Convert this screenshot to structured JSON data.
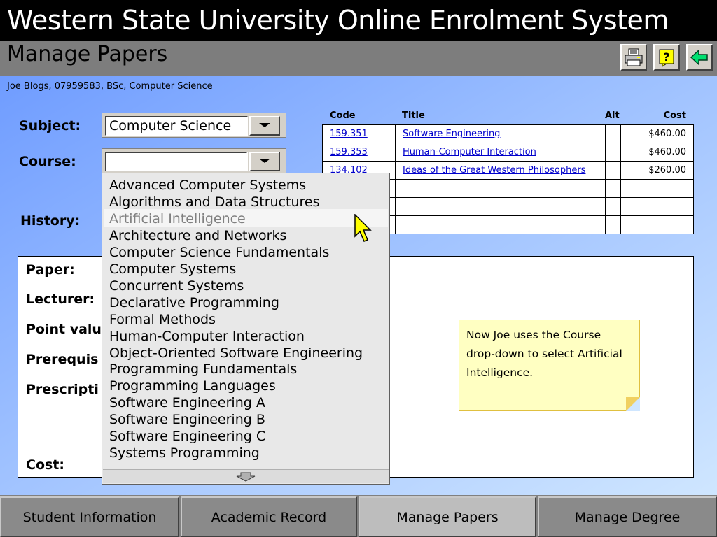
{
  "app": {
    "title": "Western State University Online Enrolment System"
  },
  "header": {
    "page_title": "Manage Papers"
  },
  "toolbar": {
    "icons": [
      "printer-icon",
      "help-icon",
      "back-arrow-icon"
    ]
  },
  "student": {
    "line": "Joe Blogs, 07959583, BSc, Computer Science"
  },
  "form": {
    "subject_label": "Subject:",
    "subject_value": "Computer Science",
    "course_label": "Course:",
    "course_value": "",
    "history_label": "History:"
  },
  "table": {
    "headers": {
      "code": "Code",
      "title": "Title",
      "alt": "Alt",
      "cost": "Cost"
    },
    "rows": [
      {
        "code": "159.351",
        "title": "Software Engineering",
        "cost": "$460.00"
      },
      {
        "code": "159.353",
        "title": "Human-Computer Interaction",
        "cost": "$460.00"
      },
      {
        "code": "134.102",
        "title": "Ideas of the Great Western Philosophers",
        "cost": "$260.00"
      }
    ]
  },
  "detail": {
    "paper_label": "Paper:",
    "lecturer_label": "Lecturer:",
    "points_label": "Point valu",
    "prereq_label": "Prerequis",
    "prescription_label": "Prescripti",
    "cost_label": "Cost:"
  },
  "note": {
    "text": "Now Joe uses the Course drop-down to select Artificial Intelligence."
  },
  "course_list": {
    "highlighted_index": 2,
    "options": [
      "Advanced Computer Systems",
      "Algorithms and Data Structures",
      "Artificial Intelligence",
      "Architecture and Networks",
      "Computer Science Fundamentals",
      "Computer Systems",
      "Concurrent Systems",
      "Declarative Programming",
      "Formal Methods",
      "Human-Computer Interaction",
      "Object-Oriented Software Engineering",
      "Programming Fundamentals",
      "Programming Languages",
      "Software Engineering A",
      "Software Engineering B",
      "Software Engineering C",
      "Systems Programming"
    ]
  },
  "tabs": [
    {
      "label": "Student Information",
      "active": false
    },
    {
      "label": "Academic Record",
      "active": false
    },
    {
      "label": "Manage Papers",
      "active": true
    },
    {
      "label": "Manage Degree",
      "active": false
    }
  ],
  "colors": {
    "accent_blue": "#6f9cff",
    "note_bg": "#ffffc2",
    "link": "#0000cc"
  }
}
